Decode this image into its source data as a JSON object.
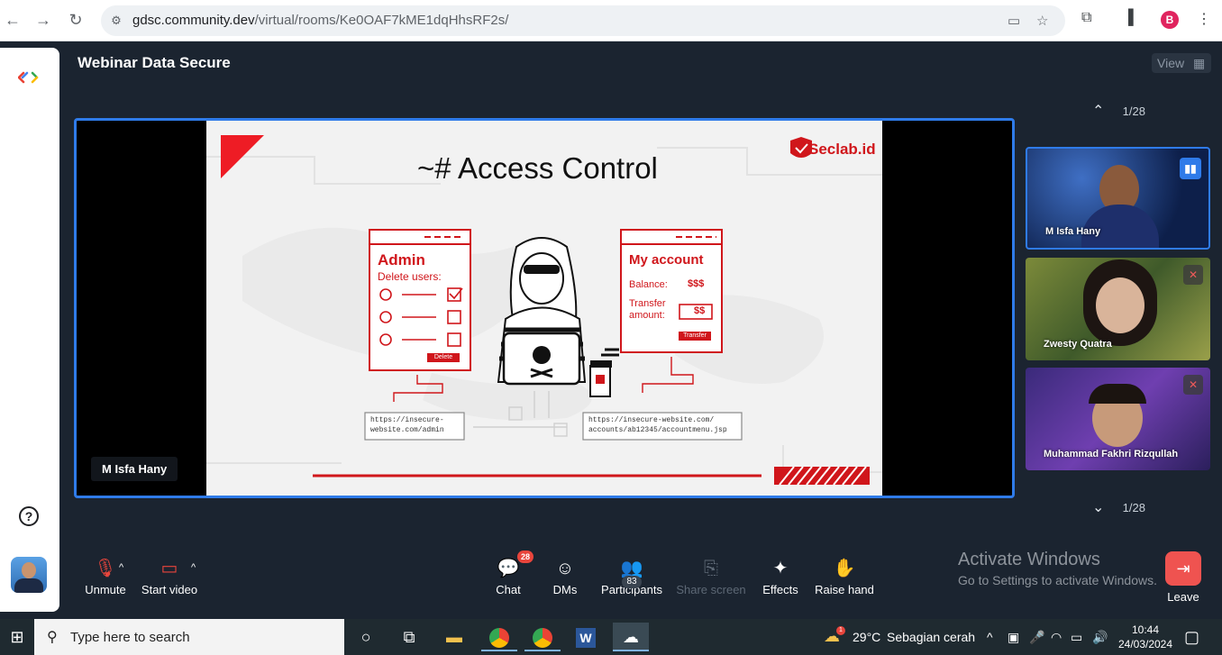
{
  "browser": {
    "url_host": "gdsc.community.dev",
    "url_path": "/virtual/rooms/Ke0OAF7kME1dqHhsRF2s/",
    "profile_initial": "B"
  },
  "room": {
    "title": "Webinar Data Secure",
    "view_label": "View"
  },
  "stage": {
    "presenter_label": "M Isfa Hany"
  },
  "slide": {
    "heading": "~# Access Control",
    "brand": "Seclab.id",
    "admin_title": "Admin",
    "admin_subtitle": "Delete users:",
    "delete_button": "Delete",
    "account_title": "My account",
    "balance_label": "Balance:",
    "balance_value": "$$$",
    "transfer_label_1": "Transfer",
    "transfer_label_2": "amount:",
    "transfer_value": "$$",
    "transfer_button": "Transfer",
    "url_admin_1": "https://insecure-",
    "url_admin_2": "website.com/admin",
    "url_account_1": "https://insecure-website.com/",
    "url_account_2": "accounts/ab12345/accountmenu.jsp"
  },
  "participants_panel": {
    "page_top": "1/28",
    "page_bottom": "1/28",
    "tiles": [
      {
        "name": "M Isfa Hany",
        "speaking": true
      },
      {
        "name": "Zwesty Quatra",
        "muted": true
      },
      {
        "name": "Muhammad Fakhri Rizqullah",
        "muted": true
      }
    ]
  },
  "controls": {
    "unmute": "Unmute",
    "start_video": "Start video",
    "chat": "Chat",
    "chat_count": "28",
    "dms": "DMs",
    "participants": "Participants",
    "participants_count": "83",
    "share_screen": "Share screen",
    "effects": "Effects",
    "raise_hand": "Raise hand",
    "leave": "Leave"
  },
  "watermark": {
    "line1": "Activate Windows",
    "line2": "Go to Settings to activate Windows."
  },
  "taskbar": {
    "search_placeholder": "Type here to search",
    "weather_temp": "29°C",
    "weather_desc": "Sebagian cerah",
    "time": "10:44",
    "date": "24/03/2024",
    "weather_badge": "1"
  },
  "colors": {
    "accent_blue": "#2f7be9",
    "danger_red": "#e8453c",
    "slide_red": "#d0161b"
  }
}
